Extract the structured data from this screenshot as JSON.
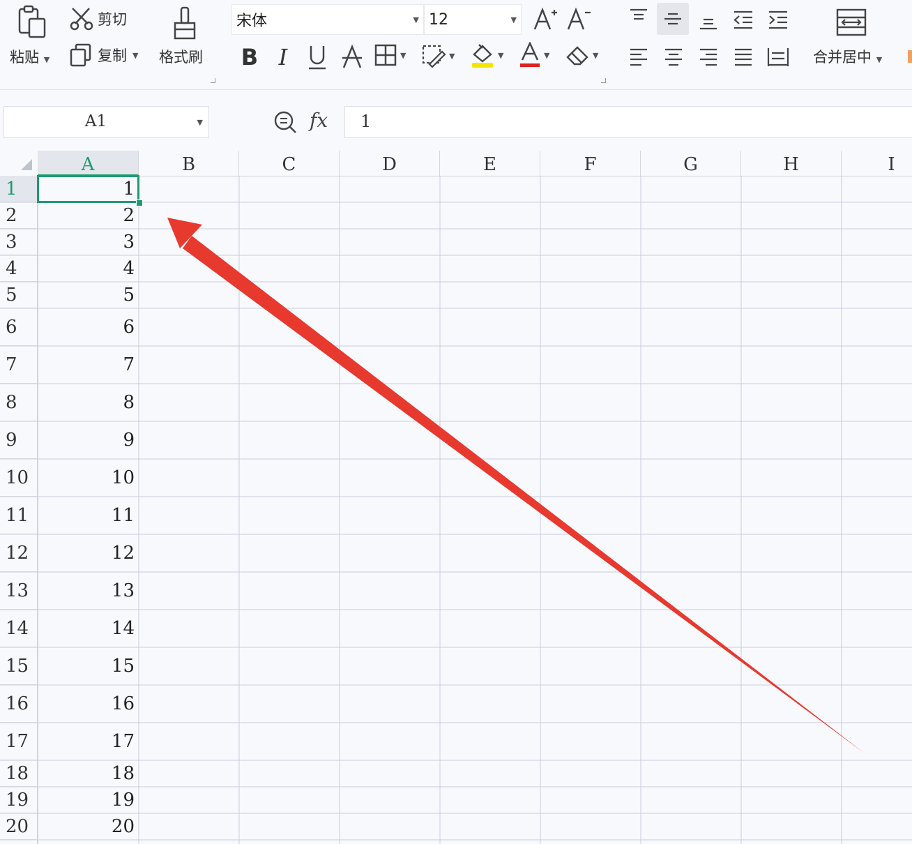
{
  "ribbon": {
    "paste_label": "粘贴",
    "cut_label": "剪切",
    "copy_label": "复制",
    "format_painter_label": "格式刷",
    "font_name": "宋体",
    "font_size": "12",
    "merge_center_label": "合并居中",
    "font_color": "#e02020",
    "fill_color": "#f5e400",
    "icons": [
      "paste-icon",
      "scissors-icon",
      "copy-icon",
      "format-painter-icon",
      "bold-icon",
      "italic-icon",
      "underline-icon",
      "strikethrough-icon",
      "borders-icon",
      "cell-format-icon",
      "fill-color-icon",
      "font-color-icon",
      "eraser-icon",
      "increase-font-icon",
      "decrease-font-icon",
      "align-top-icon",
      "align-middle-icon",
      "align-bottom-icon",
      "decrease-indent-icon",
      "increase-indent-icon",
      "align-left-icon",
      "align-center-icon",
      "align-right-icon",
      "justify-icon",
      "distributed-icon",
      "merge-center-icon"
    ]
  },
  "formula_bar": {
    "name_box": "A1",
    "fx_label": "fx",
    "value": "1"
  },
  "sheet": {
    "columns": [
      "A",
      "B",
      "C",
      "D",
      "E",
      "F",
      "G",
      "H",
      "I"
    ],
    "selected_cell": "A1",
    "rows": [
      {
        "label": "1",
        "a": "1"
      },
      {
        "label": "2",
        "a": "2"
      },
      {
        "label": "3",
        "a": "3"
      },
      {
        "label": "4",
        "a": "4"
      },
      {
        "label": "5",
        "a": "5"
      },
      {
        "label": "6",
        "a": "6"
      },
      {
        "label": "7",
        "a": "7"
      },
      {
        "label": "8",
        "a": "8"
      },
      {
        "label": "9",
        "a": "9"
      },
      {
        "label": "10",
        "a": "10"
      },
      {
        "label": "11",
        "a": "11"
      },
      {
        "label": "12",
        "a": "12"
      },
      {
        "label": "13",
        "a": "13"
      },
      {
        "label": "14",
        "a": "14"
      },
      {
        "label": "15",
        "a": "15"
      },
      {
        "label": "16",
        "a": "16"
      },
      {
        "label": "17",
        "a": "17"
      },
      {
        "label": "18",
        "a": "18"
      },
      {
        "label": "19",
        "a": "19"
      },
      {
        "label": "20",
        "a": "20"
      }
    ],
    "grid_color": "#c8cce0",
    "selection_color": "#1e9b6e"
  },
  "annotation": {
    "arrow_color": "#e8392f"
  }
}
